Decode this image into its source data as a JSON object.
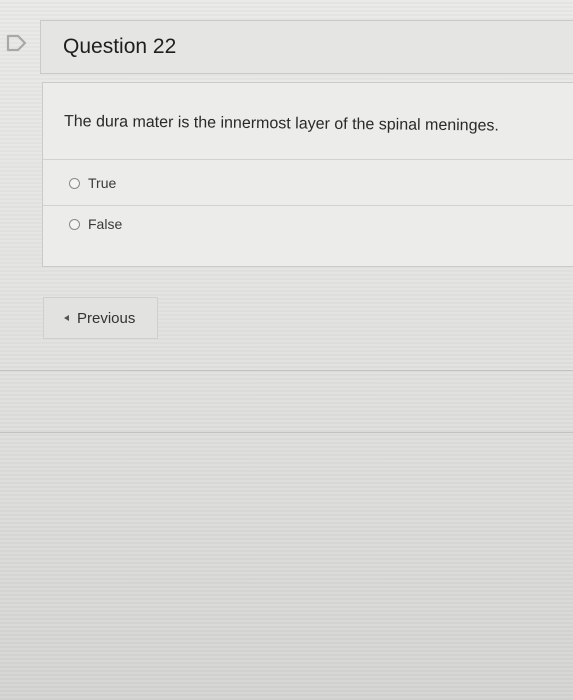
{
  "question": {
    "title": "Question 22",
    "text": "The dura mater is the innermost layer of the spinal meninges.",
    "answers": [
      {
        "label": "True"
      },
      {
        "label": "False"
      }
    ]
  },
  "navigation": {
    "previous_label": "Previous"
  },
  "icons": {
    "flag": "flag-icon",
    "previous": "chevron-left-icon"
  },
  "colors": {
    "page_background": "#e5e5e3",
    "flag_outline": "#b0b0ae"
  }
}
